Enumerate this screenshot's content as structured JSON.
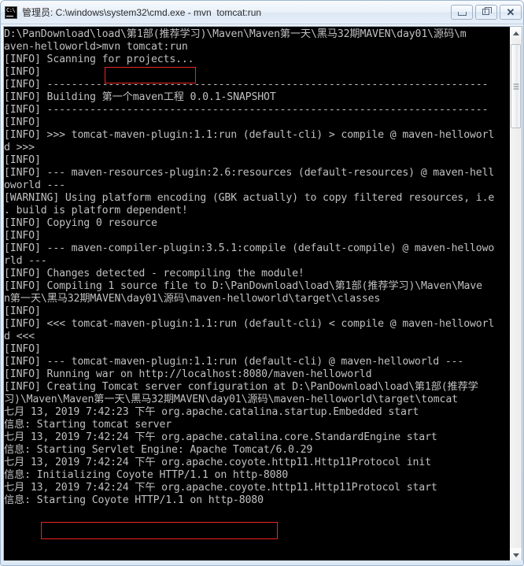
{
  "window": {
    "title": "管理员: C:\\windows\\system32\\cmd.exe - mvn  tomcat:run",
    "icon": "cmd-console-icon",
    "buttons": {
      "minimize": "minimize-button",
      "restore": "restore-button",
      "close": "close-button"
    }
  },
  "console": {
    "background_color": "#000000",
    "text_color": "#c0c0c0",
    "highlight_color": "#ee2222",
    "lines": [
      "D:\\PanDownload\\load\\第1部(推荐学习)\\Maven\\Maven第一天\\黑马32期MAVEN\\day01\\源码\\m",
      "aven-helloworld>mvn tomcat:run",
      "[INFO] Scanning for projects...",
      "[INFO]",
      "[INFO] ------------------------------------------------------------------------",
      "[INFO] Building 第一个maven工程 0.0.1-SNAPSHOT",
      "[INFO] ------------------------------------------------------------------------",
      "[INFO]",
      "[INFO] >>> tomcat-maven-plugin:1.1:run (default-cli) > compile @ maven-helloworl",
      "d >>>",
      "[INFO]",
      "[INFO] --- maven-resources-plugin:2.6:resources (default-resources) @ maven-hell",
      "oworld ---",
      "[WARNING] Using platform encoding (GBK actually) to copy filtered resources, i.e",
      ". build is platform dependent!",
      "[INFO] Copying 0 resource",
      "[INFO]",
      "[INFO] --- maven-compiler-plugin:3.5.1:compile (default-compile) @ maven-hellowo",
      "rld ---",
      "[INFO] Changes detected - recompiling the module!",
      "[INFO] Compiling 1 source file to D:\\PanDownload\\load\\第1部(推荐学习)\\Maven\\Mave",
      "n第一天\\黑马32期MAVEN\\day01\\源码\\maven-helloworld\\target\\classes",
      "[INFO]",
      "[INFO] <<< tomcat-maven-plugin:1.1:run (default-cli) < compile @ maven-helloworl",
      "d <<<",
      "[INFO]",
      "[INFO] --- tomcat-maven-plugin:1.1:run (default-cli) @ maven-helloworld ---",
      "[INFO] Running war on http://localhost:8080/maven-helloworld",
      "[INFO] Creating Tomcat server configuration at D:\\PanDownload\\load\\第1部(推荐学",
      "习)\\Maven\\Maven第一天\\黑马32期MAVEN\\day01\\源码\\maven-helloworld\\target\\tomcat",
      "七月 13, 2019 7:42:23 下午 org.apache.catalina.startup.Embedded start",
      "信息: Starting tomcat server",
      "七月 13, 2019 7:42:24 下午 org.apache.catalina.core.StandardEngine start",
      "信息: Starting Servlet Engine: Apache Tomcat/6.0.29",
      "七月 13, 2019 7:42:24 下午 org.apache.coyote.http11.Http11Protocol init",
      "信息: Initializing Coyote HTTP/1.1 on http-8080",
      "七月 13, 2019 7:42:24 下午 org.apache.coyote.http11.Http11Protocol start",
      "信息: Starting Coyote HTTP/1.1 on http-8080"
    ],
    "highlights": [
      {
        "id": "redbox-cmd",
        "text": "mvn tomcat:run"
      },
      {
        "id": "redbox-coyote",
        "text": "Starting Coyote HTTP/1.1 on http-8080"
      }
    ]
  },
  "scrollbar": {
    "up_arrow": "scroll-up-arrow-icon",
    "down_arrow": "scroll-down-arrow-icon",
    "thumb": "scroll-thumb"
  }
}
